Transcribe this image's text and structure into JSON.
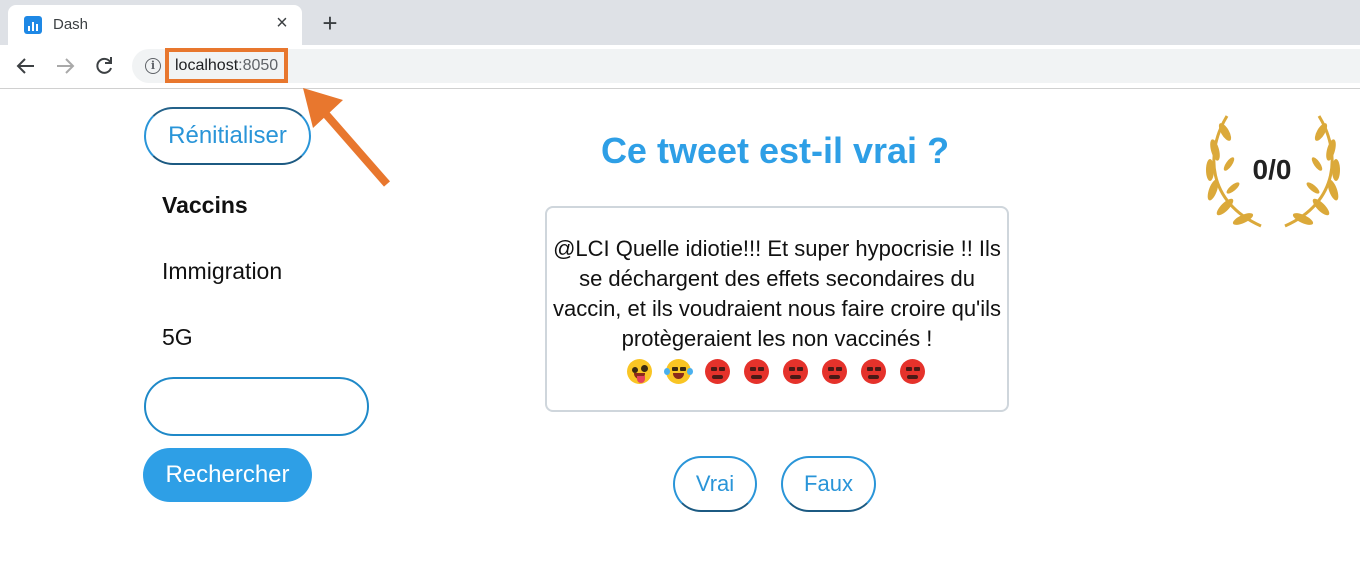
{
  "browser": {
    "tab_title": "Dash",
    "tab_close_glyph": "×",
    "new_tab_glyph": "+",
    "url_host": "localhost",
    "url_port": ":8050",
    "icons": [
      "dash-favicon-icon",
      "close-icon",
      "plus-icon",
      "back-arrow-icon",
      "forward-arrow-icon",
      "reload-icon",
      "info-icon"
    ]
  },
  "annotation": {
    "color": "#e8772e"
  },
  "sidebar": {
    "reset_label": "Rénitialiser",
    "topics": [
      {
        "label": "Vaccins",
        "active": true
      },
      {
        "label": "Immigration",
        "active": false
      },
      {
        "label": "5G",
        "active": false
      }
    ],
    "search": {
      "value": "",
      "button_label": "Rechercher"
    }
  },
  "main": {
    "title": "Ce tweet est-il vrai ?",
    "tweet_text": "@LCI Quelle idiotie!!! Et super hypocrisie !! Ils se déchargent des effets secondaires du vaccin, et ils voudraient nous faire croire qu'ils protègeraient les non vaccinés !",
    "tweet_emojis": [
      "crazy-face",
      "laughing-tears",
      "angry-face",
      "angry-face",
      "angry-face",
      "angry-face",
      "angry-face",
      "angry-face"
    ],
    "true_label": "Vrai",
    "false_label": "Faux"
  },
  "score": {
    "text": "0/0",
    "laurel_color": "#dba93a"
  },
  "colors": {
    "accent": "#2e9fe6",
    "outline": "#1f89c8"
  }
}
